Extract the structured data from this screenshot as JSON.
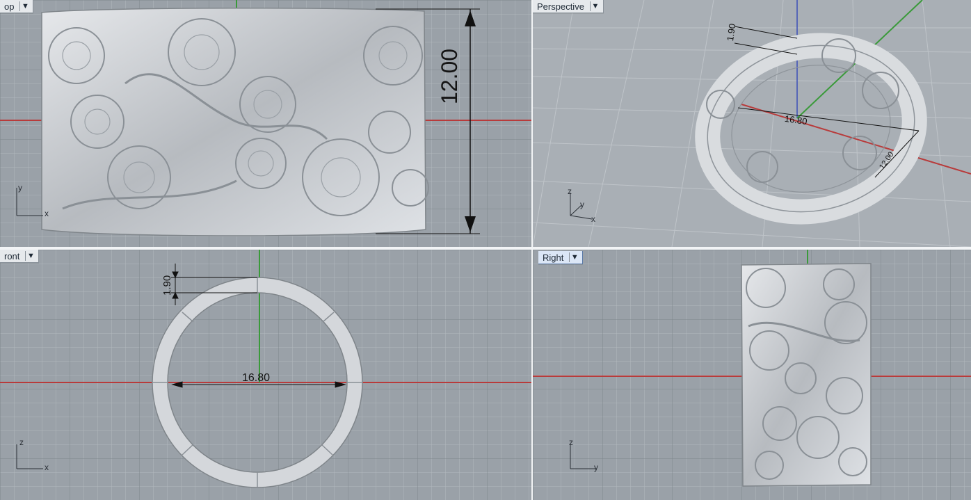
{
  "viewports": {
    "top": {
      "name": "op",
      "dimension_label": "12.00",
      "axis": {
        "v": "y",
        "h": "x"
      }
    },
    "perspective": {
      "name": "Perspective",
      "dim_a": "1.90",
      "dim_b": "16.80",
      "dim_c": "12.00",
      "axis": {
        "v": "z",
        "d": "y",
        "h": "x"
      }
    },
    "front": {
      "name": "ront",
      "dim_a": "1.90",
      "dim_b": "16.80",
      "axis": {
        "v": "z",
        "h": "x"
      }
    },
    "right": {
      "name": "Right",
      "axis": {
        "v": "z",
        "h": "y"
      }
    }
  },
  "colors": {
    "background": "#9aa1a8",
    "grid_minor": "#b3b9be",
    "grid_major": "#7e868d",
    "axis_red": "#b83b3b",
    "axis_green": "#3a9a3a",
    "axis_blue": "#3b4fb8",
    "metal": "#cfd2d6"
  },
  "icons": {
    "dropdown": "chevron-down-icon"
  }
}
